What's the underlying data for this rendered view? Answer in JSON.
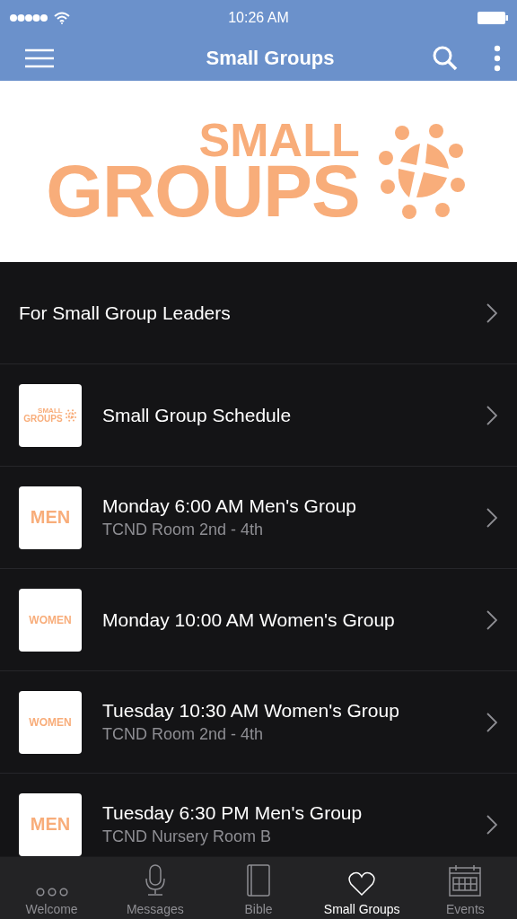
{
  "status_bar": {
    "time": "10:26 AM"
  },
  "nav": {
    "title": "Small Groups"
  },
  "banner": {
    "line_1": "SMALL",
    "line_2": "GROUPS"
  },
  "rows": [
    {
      "kind": "plain",
      "title": "For Small Group Leaders"
    },
    {
      "kind": "thumb",
      "thumb": {
        "kind": "logo",
        "line_1": "SMALL",
        "line_2": "GROUPS"
      },
      "title": "Small Group Schedule"
    },
    {
      "kind": "thumb",
      "thumb": {
        "kind": "word",
        "text": "MEN"
      },
      "title": "Monday 6:00 AM Men's Group",
      "subtitle": "TCND Room 2nd - 4th"
    },
    {
      "kind": "thumb",
      "thumb": {
        "kind": "word",
        "text": "WOMEN"
      },
      "title": "Monday 10:00 AM Women's Group"
    },
    {
      "kind": "thumb",
      "thumb": {
        "kind": "word",
        "text": "WOMEN"
      },
      "title": "Tuesday 10:30 AM Women's Group",
      "subtitle": "TCND Room 2nd - 4th"
    },
    {
      "kind": "thumb",
      "thumb": {
        "kind": "word",
        "text": "MEN"
      },
      "title": "Tuesday 6:30 PM Men's Group",
      "subtitle": "TCND Nursery Room B"
    }
  ],
  "tabs": [
    {
      "kind": "dots",
      "label": "Welcome",
      "selected": false
    },
    {
      "kind": "mic",
      "label": "Messages",
      "selected": false
    },
    {
      "kind": "book",
      "label": "Bible",
      "selected": false
    },
    {
      "kind": "heart",
      "label": "Small Groups",
      "selected": true
    },
    {
      "kind": "calendar",
      "label": "Events",
      "selected": false
    }
  ]
}
